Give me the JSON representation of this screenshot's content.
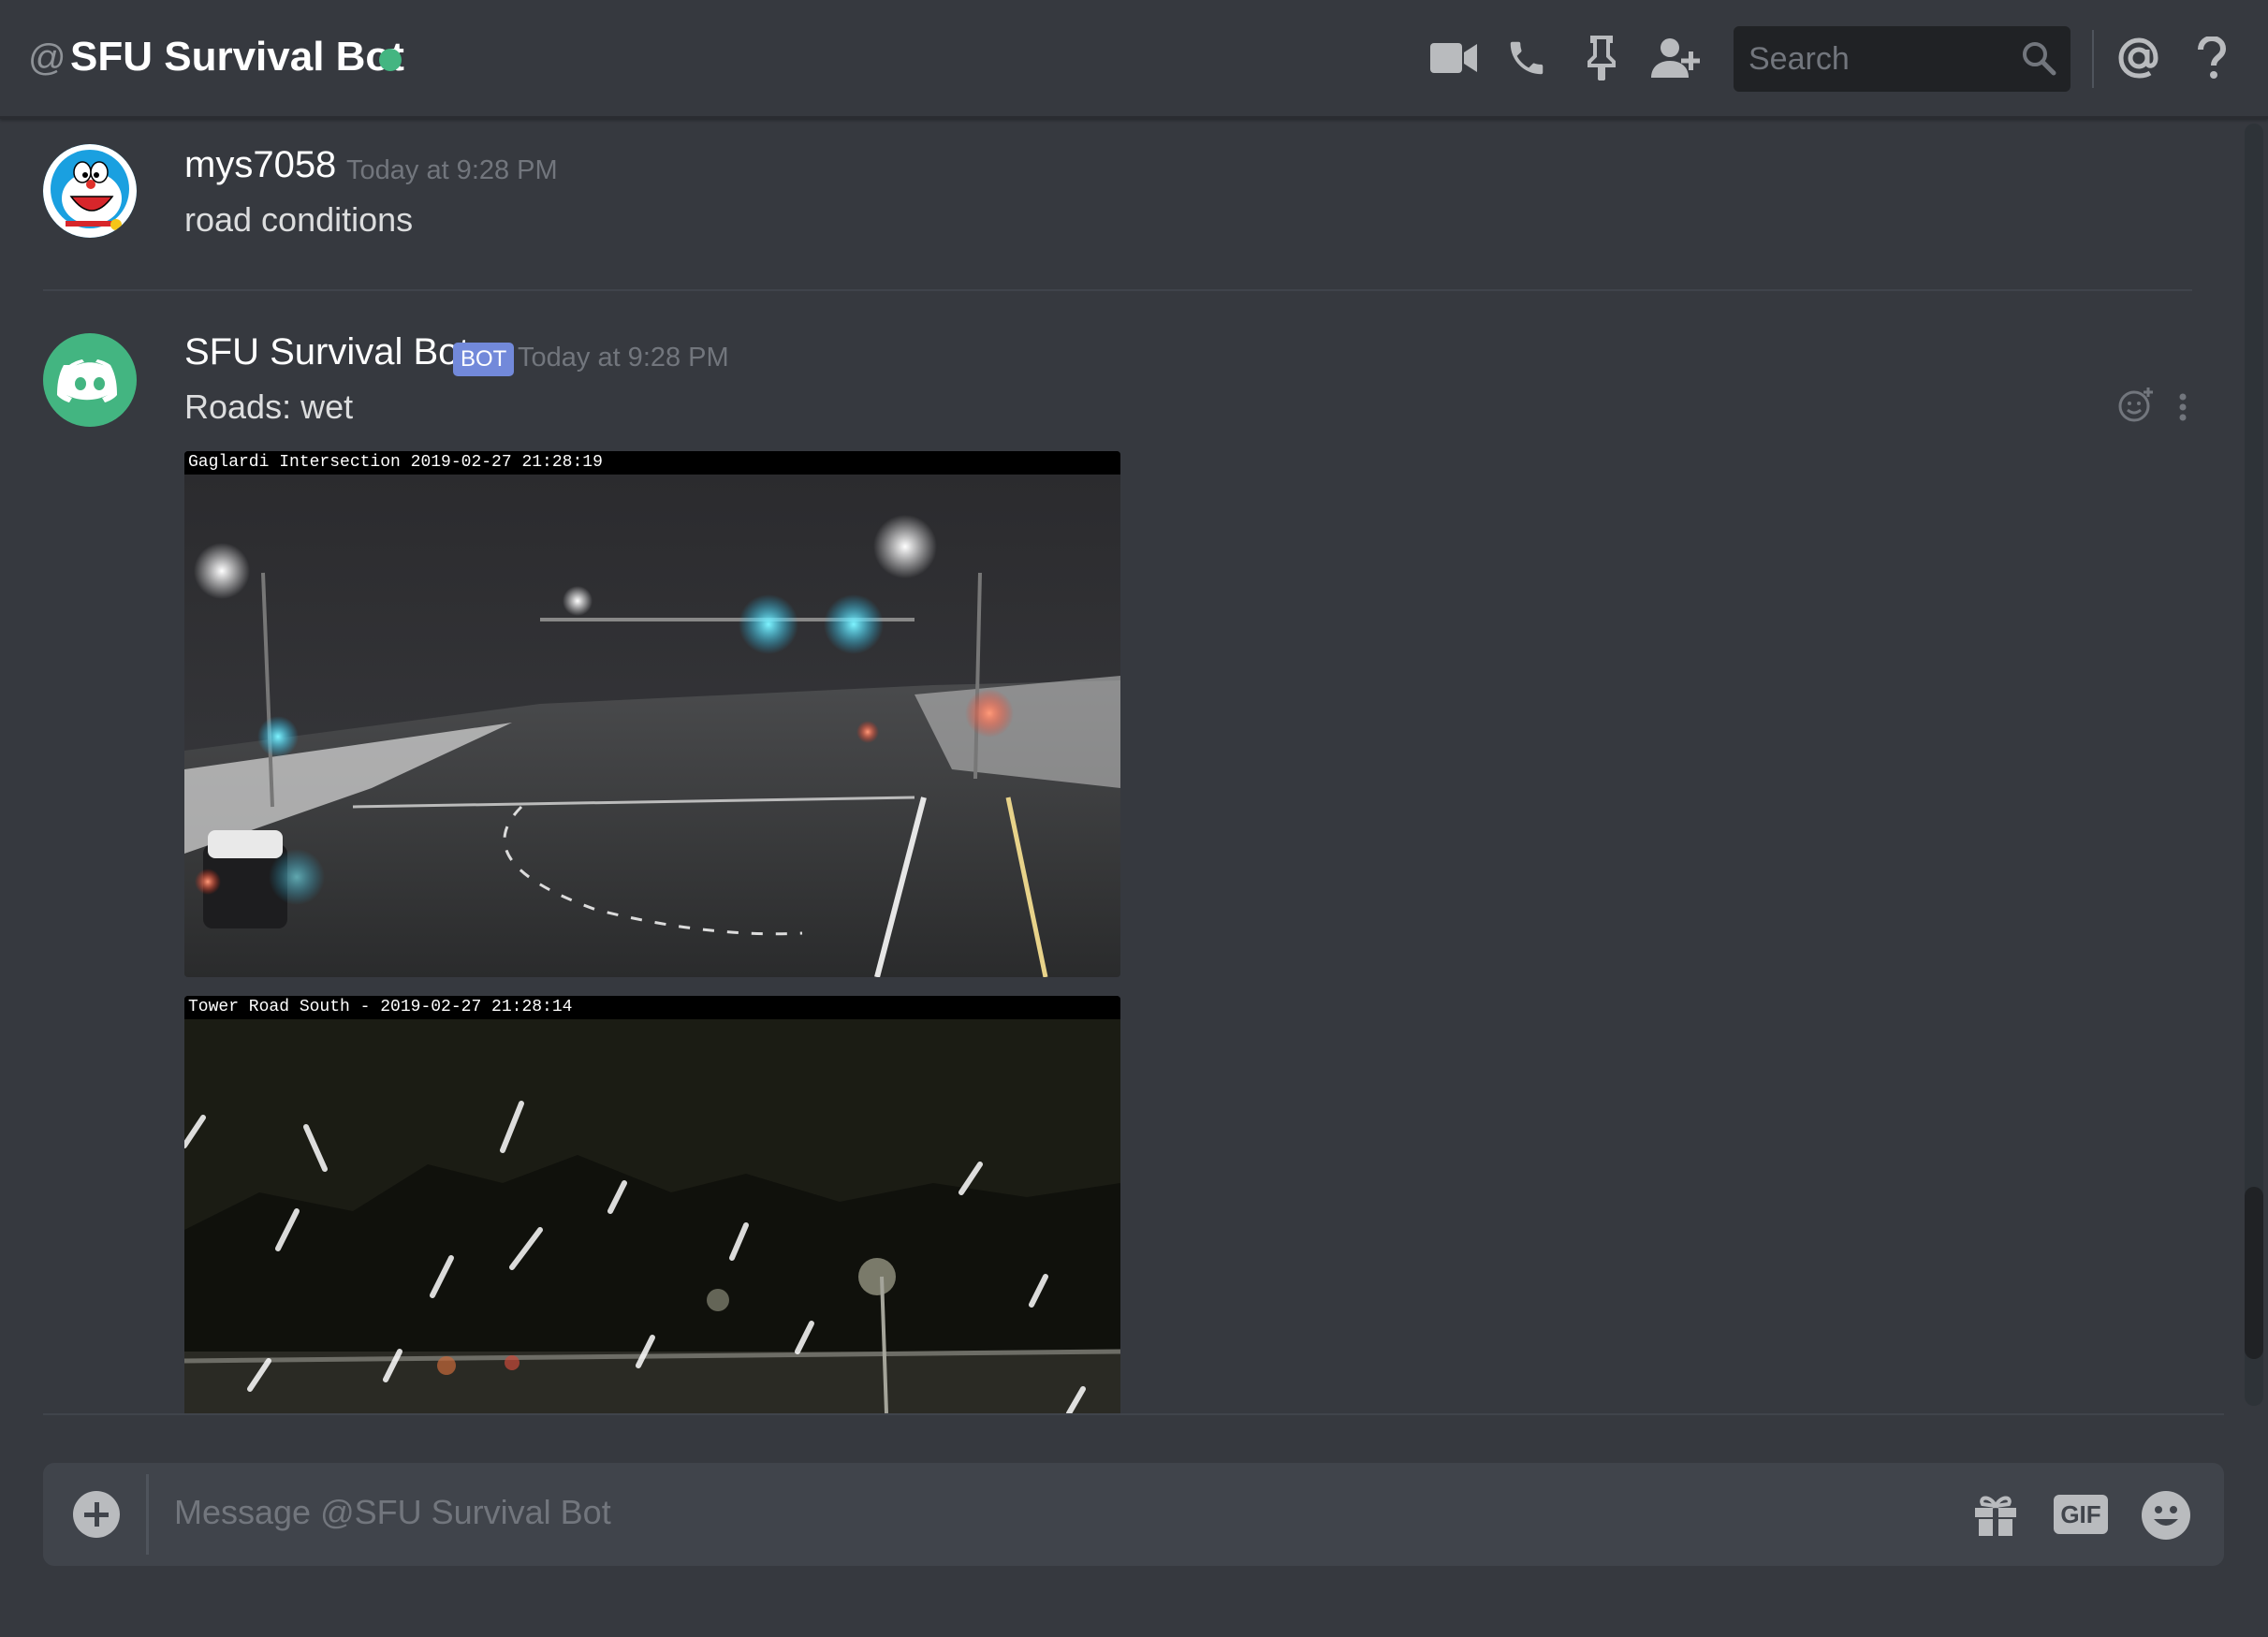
{
  "header": {
    "at_symbol": "@",
    "title": "SFU Survival Bot",
    "status_color": "#43b581",
    "icons": [
      "video-camera-icon",
      "phone-icon",
      "pin-icon",
      "add-friend-icon",
      "mention-icon",
      "help-icon"
    ],
    "search": {
      "placeholder": "Search"
    }
  },
  "messages": [
    {
      "author": "mys7058",
      "timestamp": "Today at 9:28 PM",
      "text": "road conditions",
      "avatar": "doraemon-avatar"
    },
    {
      "author": "SFU Survival Bot",
      "bot_tag": "BOT",
      "timestamp": "Today at 9:28 PM",
      "text": "Roads: wet",
      "avatar": "discord-logo-avatar",
      "avatar_color": "#43b581",
      "attachments": [
        {
          "caption": "Gaglardi Intersection 2019-02-27 21:28:19"
        },
        {
          "caption": "Tower Road South - 2019-02-27 21:28:14"
        }
      ]
    }
  ],
  "composer": {
    "placeholder": "Message @SFU Survival Bot",
    "gif_label": "GIF"
  }
}
